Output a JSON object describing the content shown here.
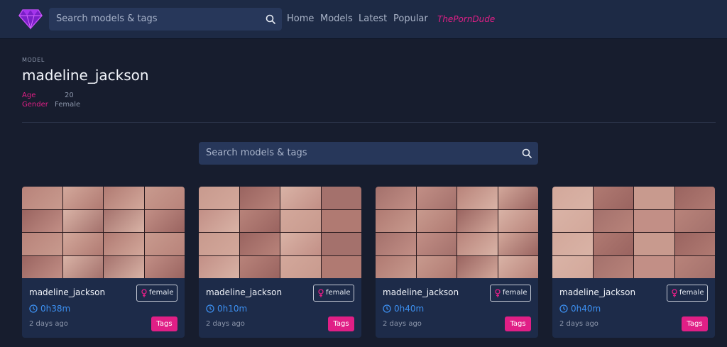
{
  "header": {
    "search_placeholder": "Search models & tags",
    "nav": {
      "home": "Home",
      "models": "Models",
      "latest": "Latest",
      "popular": "Popular",
      "partner": "ThePornDude"
    },
    "icons": {
      "logo": "diamond-logo",
      "search": "search-icon"
    }
  },
  "profile": {
    "section_label": "MODEL",
    "name": "madeline_jackson",
    "age_label": "Age",
    "age_value": "20",
    "gender_label": "Gender",
    "gender_value": "Female"
  },
  "content_search": {
    "placeholder": "Search models & tags"
  },
  "cards": [
    {
      "title": "madeline_jackson",
      "gender": "female",
      "duration": "0h38m",
      "age": "2 days ago",
      "tags_label": "Tags"
    },
    {
      "title": "madeline_jackson",
      "gender": "female",
      "duration": "0h10m",
      "age": "2 days ago",
      "tags_label": "Tags"
    },
    {
      "title": "madeline_jackson",
      "gender": "female",
      "duration": "0h40m",
      "age": "2 days ago",
      "tags_label": "Tags"
    },
    {
      "title": "madeline_jackson",
      "gender": "female",
      "duration": "0h40m",
      "age": "2 days ago",
      "tags_label": "Tags"
    }
  ],
  "colors": {
    "background": "#171d2e",
    "header": "#1d2a45",
    "card": "#1d2b49",
    "accent_pink": "#e01f86",
    "duration_blue": "#3c8ff0",
    "logo_purple": "#b42cf0"
  }
}
